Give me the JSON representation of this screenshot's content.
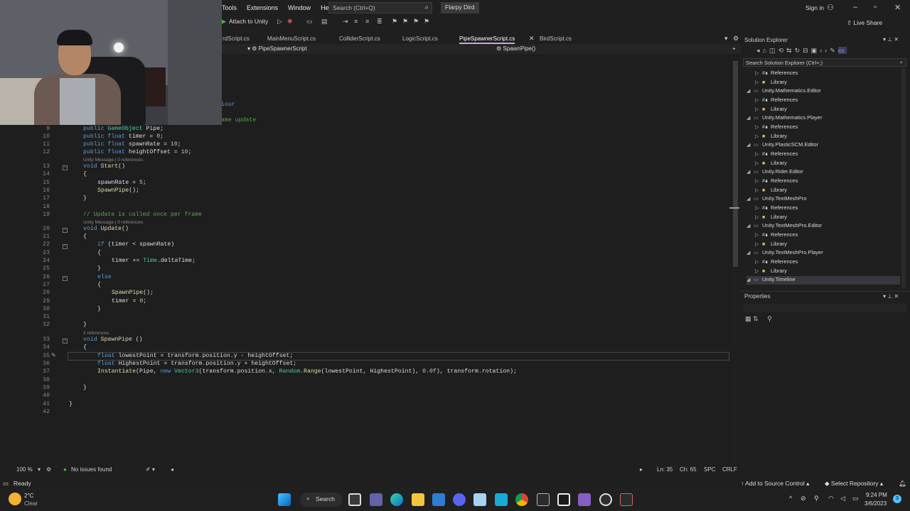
{
  "menubar": {
    "items": [
      "Tools",
      "Extensions",
      "Window",
      "Help"
    ],
    "search_placeholder": "Search (Ctrl+Q)",
    "solution_name": "Flarpy Dird",
    "sign_in": "Sign in"
  },
  "toolbar": {
    "attach_label": "Attach to Unity",
    "live_share": "Live Share"
  },
  "tabs": [
    {
      "label": "BirdScript.cs",
      "display": "rdScript.cs",
      "active": false
    },
    {
      "label": "MainMenuScript.cs",
      "active": false
    },
    {
      "label": "ColliderScript.cs",
      "active": false
    },
    {
      "label": "LogicScript.cs",
      "active": false
    },
    {
      "label": "PipeSpawnerScript.cs",
      "active": true
    },
    {
      "label": "BirdScript.cs",
      "active": false
    }
  ],
  "navbar": {
    "class_selector": "PipeSpawnerScript",
    "member_selector": "SpawnPipe()"
  },
  "code_fragments": {
    "frag1": "iour",
    "frag2": "ame update"
  },
  "code_lines": [
    {
      "n": "9",
      "text": "public GameObject Pipe;"
    },
    {
      "n": "10",
      "text": "public float timer = 0;"
    },
    {
      "n": "11",
      "text": "public float spawnRate = 10;"
    },
    {
      "n": "12",
      "text": "public float heightOffset = 10;"
    },
    {
      "n": "13",
      "text": "void Start()"
    },
    {
      "n": "14",
      "text": "{"
    },
    {
      "n": "15",
      "text": "spawnRate = 5;"
    },
    {
      "n": "16",
      "text": "SpawnPipe();"
    },
    {
      "n": "17",
      "text": "}"
    },
    {
      "n": "18",
      "text": ""
    },
    {
      "n": "19",
      "text": "// Update is called once per frame"
    },
    {
      "n": "20",
      "text": "void Update()"
    },
    {
      "n": "21",
      "text": "{"
    },
    {
      "n": "22",
      "text": "if (timer < spawnRate)"
    },
    {
      "n": "23",
      "text": "{"
    },
    {
      "n": "24",
      "text": "timer += Time.deltaTime;"
    },
    {
      "n": "25",
      "text": "}"
    },
    {
      "n": "26",
      "text": "else"
    },
    {
      "n": "27",
      "text": "{"
    },
    {
      "n": "28",
      "text": "SpawnPipe();"
    },
    {
      "n": "29",
      "text": "timer = 0;"
    },
    {
      "n": "30",
      "text": "}"
    },
    {
      "n": "31",
      "text": ""
    },
    {
      "n": "32",
      "text": "}"
    },
    {
      "n": "33",
      "text": "void SpawnPipe ()"
    },
    {
      "n": "34",
      "text": "{"
    },
    {
      "n": "35",
      "text": "float lowestPoint = transform.position.y - heightOffset;"
    },
    {
      "n": "36",
      "text": "float HighestPoint = transform.position.y + heightOffset;"
    },
    {
      "n": "37",
      "text": "Instantiate(Pipe, new Vector3(transform.position.x, Random.Range(lowestPoint, HighestPoint), 0.0f), transform.rotation);"
    },
    {
      "n": "38",
      "text": ""
    },
    {
      "n": "39",
      "text": "}"
    },
    {
      "n": "40",
      "text": ""
    },
    {
      "n": "41",
      "text": "}"
    },
    {
      "n": "42",
      "text": ""
    }
  ],
  "codelens": {
    "start": "Unity Message | 0 references",
    "update": "Unity Message | 0 references",
    "spawn": "2 references"
  },
  "editor_status": {
    "zoom": "100 %",
    "issues": "No issues found",
    "line": "Ln: 35",
    "col": "Ch: 65",
    "spc": "SPC",
    "crlf": "CRLF"
  },
  "solution_explorer": {
    "title": "Solution Explorer",
    "search_placeholder": "Search Solution Explorer (Ctrl+;)",
    "rows": [
      {
        "label": "References",
        "kind": "ref",
        "indent": 1
      },
      {
        "label": "Library",
        "kind": "folder",
        "indent": 1
      },
      {
        "label": "Unity.Mathematics.Editor",
        "kind": "project",
        "indent": 0
      },
      {
        "label": "References",
        "kind": "ref",
        "indent": 1
      },
      {
        "label": "Library",
        "kind": "folder",
        "indent": 1
      },
      {
        "label": "Unity.Mathematics.Player",
        "kind": "project",
        "indent": 0
      },
      {
        "label": "References",
        "kind": "ref",
        "indent": 1
      },
      {
        "label": "Library",
        "kind": "folder",
        "indent": 1
      },
      {
        "label": "Unity.PlasticSCM.Editor",
        "kind": "project",
        "indent": 0
      },
      {
        "label": "References",
        "kind": "ref",
        "indent": 1
      },
      {
        "label": "Library",
        "kind": "folder",
        "indent": 1
      },
      {
        "label": "Unity.Rider.Editor",
        "kind": "project",
        "indent": 0
      },
      {
        "label": "References",
        "kind": "ref",
        "indent": 1
      },
      {
        "label": "Library",
        "kind": "folder",
        "indent": 1
      },
      {
        "label": "Unity.TextMeshPro",
        "kind": "project",
        "indent": 0
      },
      {
        "label": "References",
        "kind": "ref",
        "indent": 1
      },
      {
        "label": "Library",
        "kind": "folder",
        "indent": 1
      },
      {
        "label": "Unity.TextMeshPro.Editor",
        "kind": "project",
        "indent": 0
      },
      {
        "label": "References",
        "kind": "ref",
        "indent": 1
      },
      {
        "label": "Library",
        "kind": "folder",
        "indent": 1
      },
      {
        "label": "Unity.TextMeshPro.Player",
        "kind": "project",
        "indent": 0
      },
      {
        "label": "References",
        "kind": "ref",
        "indent": 1
      },
      {
        "label": "Library",
        "kind": "folder",
        "indent": 1
      },
      {
        "label": "Unity.Timeline",
        "kind": "project",
        "indent": 0,
        "selected": true
      }
    ]
  },
  "properties": {
    "title": "Properties"
  },
  "status": {
    "ready": "Ready",
    "source_control": "Add to Source Control",
    "repository": "Select Repository"
  },
  "taskbar": {
    "weather_temp": "2°C",
    "weather_desc": "Clear",
    "search_label": "Search",
    "time": "9:24 PM",
    "date": "3/6/2023",
    "notification_count": "3"
  },
  "colors": {
    "accent": "#d7a0e8",
    "editor_bg": "#1e1e1e",
    "keyword": "#569cd6",
    "type": "#4ec9b0",
    "comment": "#57a64a"
  }
}
